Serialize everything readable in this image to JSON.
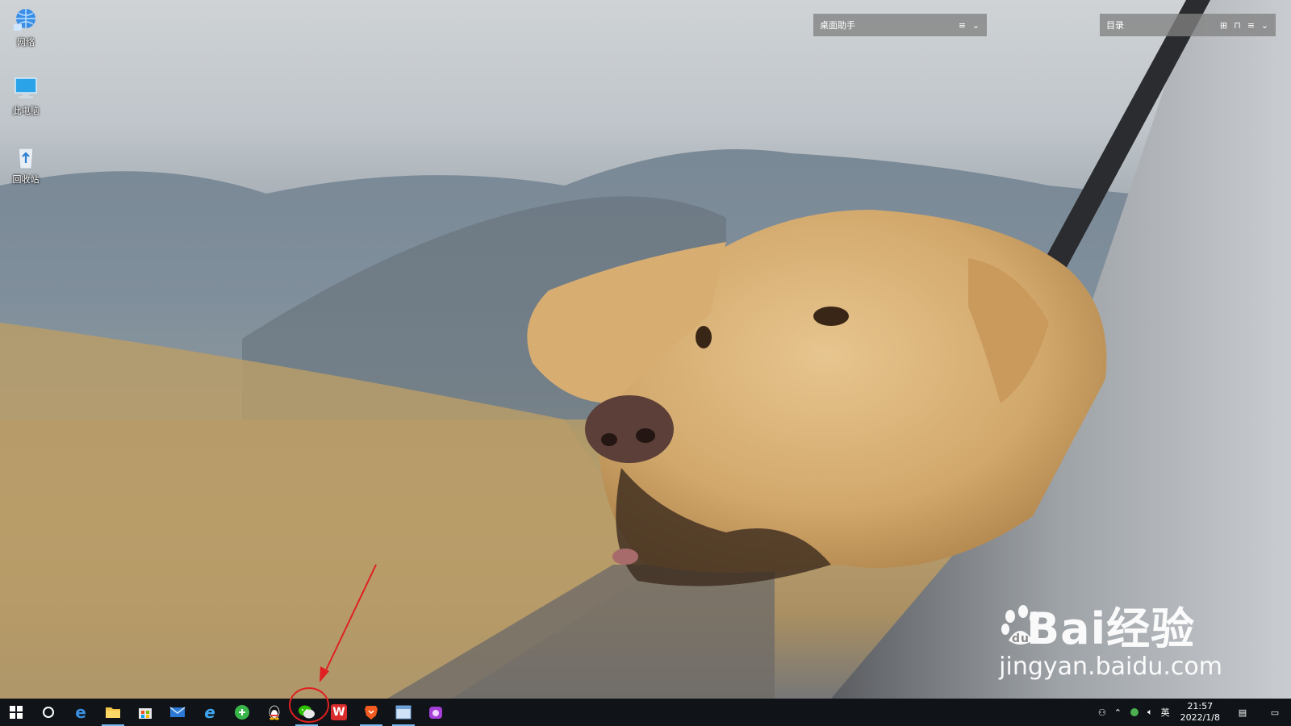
{
  "desktop": {
    "icons": [
      {
        "label": "网络",
        "icon": "network-icon"
      },
      {
        "label": "此电脑",
        "icon": "this-pc-icon"
      },
      {
        "label": "回收站",
        "icon": "recycle-bin-icon"
      }
    ]
  },
  "widgets": {
    "assistant": {
      "title": "桌面助手"
    },
    "catalog": {
      "title": "目录"
    }
  },
  "watermark": {
    "brand_left": "Bai",
    "brand_right": "经验",
    "url": "jingyan.baidu.com"
  },
  "taskbar": {
    "apps": [
      {
        "name": "start-button",
        "icon": "windows-logo-icon"
      },
      {
        "name": "search-button",
        "icon": "cortana-circle-icon"
      },
      {
        "name": "edge-button",
        "icon": "edge-icon"
      },
      {
        "name": "file-explorer-button",
        "icon": "folder-icon",
        "active": true
      },
      {
        "name": "store-button",
        "icon": "store-icon"
      },
      {
        "name": "mail-button",
        "icon": "mail-icon"
      },
      {
        "name": "ie-button",
        "icon": "ie-icon"
      },
      {
        "name": "green-app-button",
        "icon": "green-circle-icon"
      },
      {
        "name": "qq-button",
        "icon": "qq-penguin-icon"
      },
      {
        "name": "wechat-button",
        "icon": "wechat-icon",
        "active": true
      },
      {
        "name": "wps-button",
        "icon": "wps-icon"
      },
      {
        "name": "brave-button",
        "icon": "brave-lion-icon",
        "active": true
      },
      {
        "name": "app-window-button",
        "icon": "window-icon",
        "active": true
      },
      {
        "name": "camera-app-button",
        "icon": "purple-camera-icon"
      }
    ],
    "tray": {
      "ime": "英",
      "time": "21:57",
      "date": "2022/1/8"
    }
  },
  "colors": {
    "taskbar": "#101418",
    "annotation": "#e02020",
    "wechat": "#2dc100",
    "wps": "#d92b2b",
    "brave": "#f25b1f"
  }
}
